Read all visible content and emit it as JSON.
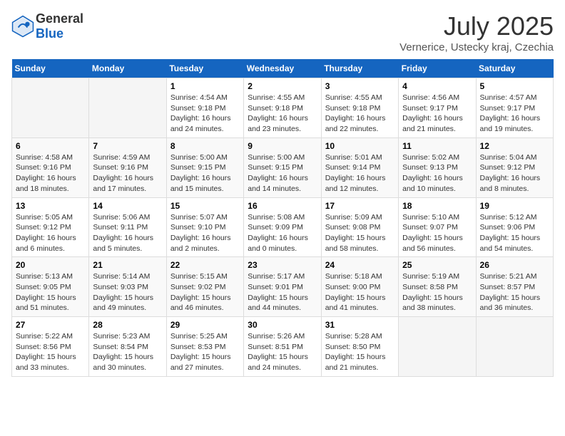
{
  "header": {
    "logo_general": "General",
    "logo_blue": "Blue",
    "month": "July 2025",
    "location": "Vernerice, Ustecky kraj, Czechia"
  },
  "days_of_week": [
    "Sunday",
    "Monday",
    "Tuesday",
    "Wednesday",
    "Thursday",
    "Friday",
    "Saturday"
  ],
  "weeks": [
    [
      {
        "day": "",
        "info": ""
      },
      {
        "day": "",
        "info": ""
      },
      {
        "day": "1",
        "info": "Sunrise: 4:54 AM\nSunset: 9:18 PM\nDaylight: 16 hours and 24 minutes."
      },
      {
        "day": "2",
        "info": "Sunrise: 4:55 AM\nSunset: 9:18 PM\nDaylight: 16 hours and 23 minutes."
      },
      {
        "day": "3",
        "info": "Sunrise: 4:55 AM\nSunset: 9:18 PM\nDaylight: 16 hours and 22 minutes."
      },
      {
        "day": "4",
        "info": "Sunrise: 4:56 AM\nSunset: 9:17 PM\nDaylight: 16 hours and 21 minutes."
      },
      {
        "day": "5",
        "info": "Sunrise: 4:57 AM\nSunset: 9:17 PM\nDaylight: 16 hours and 19 minutes."
      }
    ],
    [
      {
        "day": "6",
        "info": "Sunrise: 4:58 AM\nSunset: 9:16 PM\nDaylight: 16 hours and 18 minutes."
      },
      {
        "day": "7",
        "info": "Sunrise: 4:59 AM\nSunset: 9:16 PM\nDaylight: 16 hours and 17 minutes."
      },
      {
        "day": "8",
        "info": "Sunrise: 5:00 AM\nSunset: 9:15 PM\nDaylight: 16 hours and 15 minutes."
      },
      {
        "day": "9",
        "info": "Sunrise: 5:00 AM\nSunset: 9:15 PM\nDaylight: 16 hours and 14 minutes."
      },
      {
        "day": "10",
        "info": "Sunrise: 5:01 AM\nSunset: 9:14 PM\nDaylight: 16 hours and 12 minutes."
      },
      {
        "day": "11",
        "info": "Sunrise: 5:02 AM\nSunset: 9:13 PM\nDaylight: 16 hours and 10 minutes."
      },
      {
        "day": "12",
        "info": "Sunrise: 5:04 AM\nSunset: 9:12 PM\nDaylight: 16 hours and 8 minutes."
      }
    ],
    [
      {
        "day": "13",
        "info": "Sunrise: 5:05 AM\nSunset: 9:12 PM\nDaylight: 16 hours and 6 minutes."
      },
      {
        "day": "14",
        "info": "Sunrise: 5:06 AM\nSunset: 9:11 PM\nDaylight: 16 hours and 5 minutes."
      },
      {
        "day": "15",
        "info": "Sunrise: 5:07 AM\nSunset: 9:10 PM\nDaylight: 16 hours and 2 minutes."
      },
      {
        "day": "16",
        "info": "Sunrise: 5:08 AM\nSunset: 9:09 PM\nDaylight: 16 hours and 0 minutes."
      },
      {
        "day": "17",
        "info": "Sunrise: 5:09 AM\nSunset: 9:08 PM\nDaylight: 15 hours and 58 minutes."
      },
      {
        "day": "18",
        "info": "Sunrise: 5:10 AM\nSunset: 9:07 PM\nDaylight: 15 hours and 56 minutes."
      },
      {
        "day": "19",
        "info": "Sunrise: 5:12 AM\nSunset: 9:06 PM\nDaylight: 15 hours and 54 minutes."
      }
    ],
    [
      {
        "day": "20",
        "info": "Sunrise: 5:13 AM\nSunset: 9:05 PM\nDaylight: 15 hours and 51 minutes."
      },
      {
        "day": "21",
        "info": "Sunrise: 5:14 AM\nSunset: 9:03 PM\nDaylight: 15 hours and 49 minutes."
      },
      {
        "day": "22",
        "info": "Sunrise: 5:15 AM\nSunset: 9:02 PM\nDaylight: 15 hours and 46 minutes."
      },
      {
        "day": "23",
        "info": "Sunrise: 5:17 AM\nSunset: 9:01 PM\nDaylight: 15 hours and 44 minutes."
      },
      {
        "day": "24",
        "info": "Sunrise: 5:18 AM\nSunset: 9:00 PM\nDaylight: 15 hours and 41 minutes."
      },
      {
        "day": "25",
        "info": "Sunrise: 5:19 AM\nSunset: 8:58 PM\nDaylight: 15 hours and 38 minutes."
      },
      {
        "day": "26",
        "info": "Sunrise: 5:21 AM\nSunset: 8:57 PM\nDaylight: 15 hours and 36 minutes."
      }
    ],
    [
      {
        "day": "27",
        "info": "Sunrise: 5:22 AM\nSunset: 8:56 PM\nDaylight: 15 hours and 33 minutes."
      },
      {
        "day": "28",
        "info": "Sunrise: 5:23 AM\nSunset: 8:54 PM\nDaylight: 15 hours and 30 minutes."
      },
      {
        "day": "29",
        "info": "Sunrise: 5:25 AM\nSunset: 8:53 PM\nDaylight: 15 hours and 27 minutes."
      },
      {
        "day": "30",
        "info": "Sunrise: 5:26 AM\nSunset: 8:51 PM\nDaylight: 15 hours and 24 minutes."
      },
      {
        "day": "31",
        "info": "Sunrise: 5:28 AM\nSunset: 8:50 PM\nDaylight: 15 hours and 21 minutes."
      },
      {
        "day": "",
        "info": ""
      },
      {
        "day": "",
        "info": ""
      }
    ]
  ]
}
